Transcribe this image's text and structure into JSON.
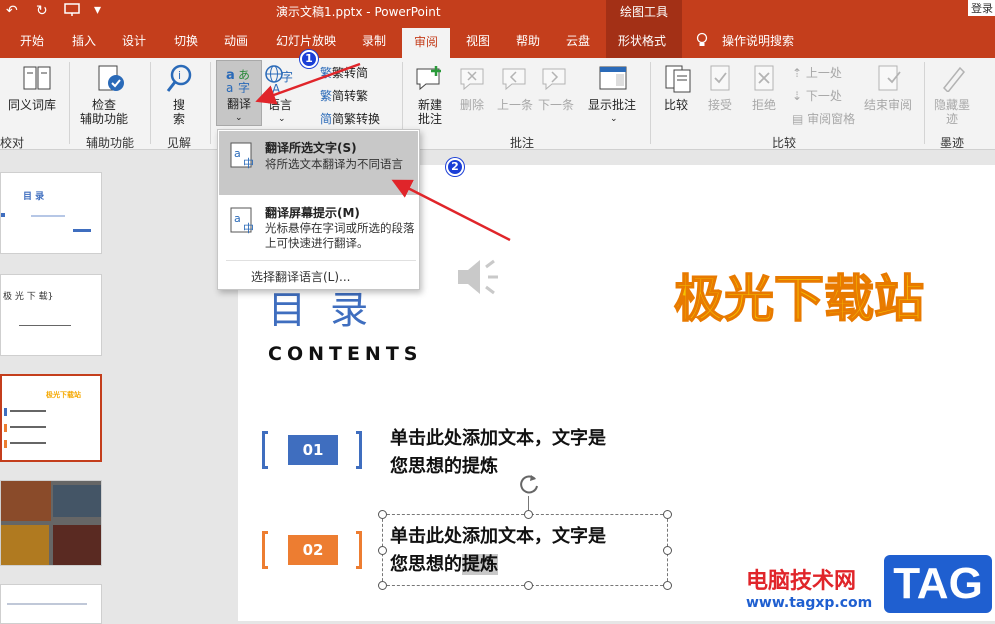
{
  "titlebar": {
    "doc_title": "演示文稿1.pptx  -  PowerPoint",
    "context_group": "绘图工具",
    "login": "登录",
    "undo": "↶",
    "redo": "↻"
  },
  "tabs": [
    "开始",
    "插入",
    "设计",
    "切换",
    "动画",
    "幻灯片放映",
    "录制",
    "审阅",
    "视图",
    "帮助",
    "云盘",
    "形状格式"
  ],
  "active_tab": "审阅",
  "tellme": "操作说明搜索",
  "ribbon": {
    "thesaurus": "同义词库",
    "check_accessibility": [
      "检查",
      "辅助功能"
    ],
    "search": [
      "搜",
      "索"
    ],
    "translate": "翻译",
    "language": "语言",
    "trad_to_simp": "繁转简",
    "simp_to_trad": "简转繁",
    "simp_trad_convert": "简繁转换",
    "new_comment": [
      "新建",
      "批注"
    ],
    "delete": "删除",
    "previous": "上一条",
    "next": "下一条",
    "show_comments": "显示批注",
    "compare": "比较",
    "accept": "接受",
    "reject": "拒绝",
    "prev_change": "上一处",
    "next_change": "下一处",
    "review_pane": "审阅窗格",
    "end_review": "结束审阅",
    "hide_ink": [
      "隐藏墨",
      "迹"
    ],
    "groups": {
      "proofing": "校对",
      "accessibility": "辅助功能",
      "insights": "见解",
      "comments": "批注",
      "compare": "比较",
      "ink": "墨迹"
    }
  },
  "menu": {
    "item1_title": "翻译所选文字(S)",
    "item1_desc": "将所选文本翻译为不同语言",
    "item2_title": "翻译屏幕提示(M)",
    "item2_desc": "光标悬停在字词或所选的段落上可快速进行翻译。",
    "item3": "选择翻译语言(L)..."
  },
  "callouts": {
    "one": "1",
    "two": "2"
  },
  "slide": {
    "heading": "目 录",
    "contents": "CONTENTS",
    "logo": "极光下载站",
    "item1_num": "01",
    "item1_text": [
      "单击此处添加文本，文字是",
      "您思想的提炼"
    ],
    "item2_num": "02",
    "item2_text_line1": "单击此处添加文本，文字是",
    "item2_text_line2a": "您思想的",
    "item2_text_line2b": "提炼"
  },
  "thumbs": {
    "t1_title": "目  录",
    "t2_text": "极 光 下 载}",
    "t3_title": "极光下载站"
  },
  "watermark": {
    "cn": "电脑技术网",
    "url": "www.tagxp.com",
    "tag": "TAG"
  },
  "colors": {
    "accent": "#c43e1c",
    "blue": "#3f6ebf",
    "orange": "#ed7d31",
    "logo_yellow": "#f5c400",
    "arrow": "#e0252a"
  }
}
